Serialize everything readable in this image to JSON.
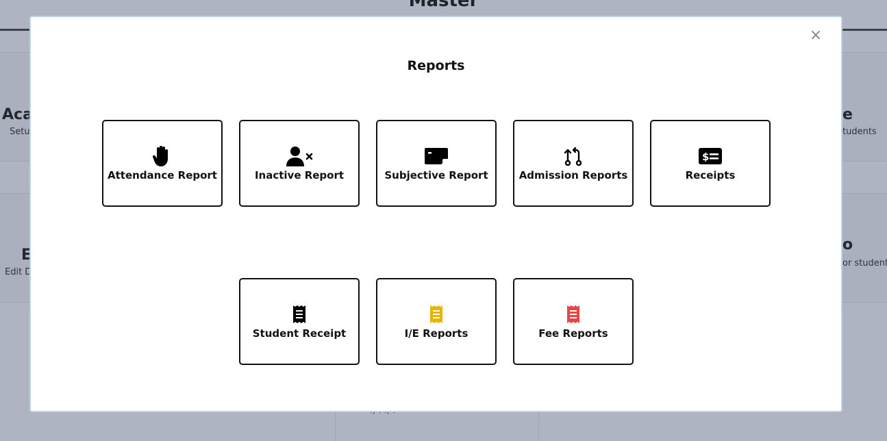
{
  "background": {
    "page_title": "Master",
    "left_heading": "Aca",
    "left_sub": "Setu",
    "right_heading": "e",
    "right_sub": "tudents",
    "left_heading2": "E",
    "left_sub2": "Edit D",
    "right_heading2": "o",
    "right_sub2": "or student",
    "bottom_fragment": "., .                       ., ."
  },
  "modal": {
    "title": "Reports",
    "close_label": "×",
    "tiles_row1": [
      {
        "label": "Attendance Report",
        "icon": "hand-icon",
        "color": "#000000"
      },
      {
        "label": "Inactive Report",
        "icon": "user-x-icon",
        "color": "#000000"
      },
      {
        "label": "Subjective Report",
        "icon": "sticky-note-icon",
        "color": "#000000"
      },
      {
        "label": "Admission Reports",
        "icon": "git-compare-icon",
        "color": "#000000"
      },
      {
        "label": "Receipts",
        "icon": "money-bill-icon",
        "color": "#000000"
      }
    ],
    "tiles_row2": [
      {
        "label": "Student Receipt",
        "icon": "receipt-icon",
        "color": "#000000"
      },
      {
        "label": "I/E Reports",
        "icon": "receipt-icon",
        "color": "#e8b400"
      },
      {
        "label": "Fee Reports",
        "icon": "receipt-icon",
        "color": "#e84545"
      }
    ]
  }
}
